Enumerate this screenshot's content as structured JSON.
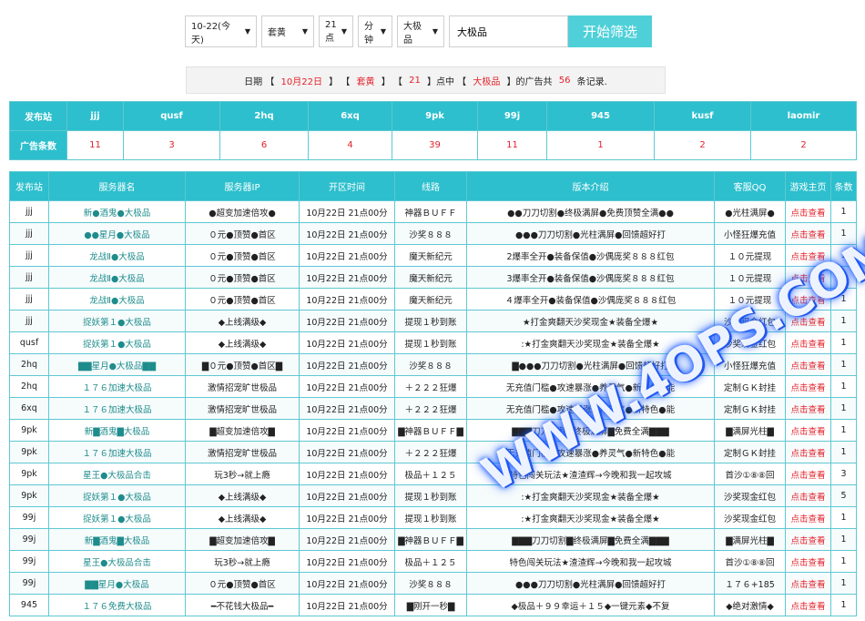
{
  "filters": {
    "date": "10-22(今天)",
    "category": "套黄",
    "hour": "21点",
    "minute": "分钟",
    "type": "大极品",
    "keyword": "大极品",
    "submit_label": "开始筛选"
  },
  "summary": {
    "prefix": "日期 【 ",
    "date": "10月22日",
    "sep1": " 】 【 ",
    "category": "套黄",
    "sep2": " 】 【 ",
    "hour": "21",
    "sep3": " 】点中 【 ",
    "type": "大极品",
    "sep4": " 】的广告共 ",
    "count": "56",
    "suffix": " 条记录."
  },
  "stats": {
    "row1_header": "发布站",
    "row2_header": "广告条数",
    "sites": [
      "jjj",
      "qusf",
      "2hq",
      "6xq",
      "9pk",
      "99j",
      "945",
      "kusf",
      "laomir"
    ],
    "counts": [
      "11",
      "3",
      "6",
      "4",
      "39",
      "11",
      "1",
      "2",
      "2"
    ]
  },
  "list": {
    "headers": [
      "发布站",
      "服务器名",
      "服务器IP",
      "开区时间",
      "线路",
      "版本介绍",
      "客服QQ",
      "游戏主页",
      "条数"
    ],
    "link_label": "点击查看",
    "rows": [
      [
        "jjj",
        "新●酒鬼●大极品",
        "●超变加速倍攻●",
        "10月22日 21点00分",
        "神器ＢＵＦＦ",
        "●●刀刀切割●终极满屏●免费顶赞全满●●",
        "●光柱满屏●",
        "1"
      ],
      [
        "jjj",
        "●●星月●大极品",
        "０元●顶赞●首区",
        "10月22日 21点00分",
        "沙奖８８８",
        "●●●刀刀切割●光柱满屏●回馈超好打",
        "小怪狂爆充值",
        "1"
      ],
      [
        "jjj",
        "龙战Ⅱ●大极品",
        "０元●顶赞●首区",
        "10月22日 21点00分",
        "魔天新纪元",
        "2爆率全开●装备保值●沙偶庞奖８８８红包",
        "１０元提现",
        "1"
      ],
      [
        "jjj",
        "龙战Ⅱ●大极品",
        "０元●顶赞●首区",
        "10月22日 21点00分",
        "魔天新纪元",
        "3爆率全开●装备保值●沙偶庞奖８８８红包",
        "１０元提现",
        "1"
      ],
      [
        "jjj",
        "龙战Ⅱ●大极品",
        "０元●顶赞●首区",
        "10月22日 21点00分",
        "魔天新纪元",
        "４爆率全开●装备保值●沙偶庞奖８８８红包",
        "１０元提现",
        "1"
      ],
      [
        "jjj",
        "捉妖第１●大极品",
        "◆上线满级◆",
        "10月22日 21点00分",
        "提现１秒到账",
        "★打金爽翻天沙奖现金★装备全爆★",
        "沙奖现金红包",
        "1"
      ],
      [
        "qusf",
        "捉妖第１●大极品",
        "◆上线满级◆",
        "10月22日 21点00分",
        "提现１秒到账",
        ":★打金爽翻天沙奖现金★装备全爆★",
        "沙奖现金红包",
        "1"
      ],
      [
        "2hq",
        "▇▇星月●大极品▇▇",
        "▇０元●顶赞●首区▇",
        "10月22日 21点00分",
        "沙奖８８８",
        "▇●●●刀刀切割●光柱满屏●回馈超好打",
        "小怪狂爆充值",
        "1"
      ],
      [
        "2hq",
        "１７６加速大极品",
        "激情招宠旷世极品",
        "10月22日 21点00分",
        "＋２２２狂爆",
        "无充值门槛●攻速暴涨●养灵气●新特色●能",
        "定制ＧＫ封挂",
        "1"
      ],
      [
        "6xq",
        "１７６加速大极品",
        "激情招宠旷世极品",
        "10月22日 21点00分",
        "＋２２２狂爆",
        "无充值门槛●攻速暴涨●养灵气●新特色●能",
        "定制ＧＫ封挂",
        "1"
      ],
      [
        "9pk",
        "新▇酒鬼▇大极品",
        "▇超变加速倍攻▇",
        "10月22日 21点00分",
        "▇神器ＢＵＦＦ▇",
        "▇▇▇刀刀切割▇终极满屏▇免费全满▇▇▇",
        "▇满屏光柱▇",
        "1"
      ],
      [
        "9pk",
        "１７６加速大极品",
        "激情招宠旷世极品",
        "10月22日 21点00分",
        "＋２２２狂爆",
        "无充值门槛●攻速暴涨●养灵气●新特色●能",
        "定制ＧＫ封挂",
        "1"
      ],
      [
        "9pk",
        "星王●大极品合击",
        "玩3秒→就上瘾",
        "10月22日 21点00分",
        "极品＋１２５",
        "特色闯关玩法★渣渣辉→今晚和我一起攻城",
        "首沙①⑧⑧回",
        "3"
      ],
      [
        "9pk",
        "捉妖第１●大极品",
        "◆上线满级◆",
        "10月22日 21点00分",
        "提现１秒到账",
        ":★打金爽翻天沙奖现金★装备全爆★",
        "沙奖现金红包",
        "5"
      ],
      [
        "99j",
        "捉妖第１●大极品",
        "◆上线满级◆",
        "10月22日 21点00分",
        "提现１秒到账",
        ":★打金爽翻天沙奖现金★装备全爆★",
        "沙奖现金红包",
        "1"
      ],
      [
        "99j",
        "新▇酒鬼▇大极品",
        "▇超变加速倍攻▇",
        "10月22日 21点00分",
        "▇神器ＢＵＦＦ▇",
        "▇▇▇刀刀切割▇终极满屏▇免费全满▇▇▇",
        "▇满屏光柱▇",
        "1"
      ],
      [
        "99j",
        "星王●大极品合击",
        "玩3秒→就上瘾",
        "10月22日 21点00分",
        "极品＋１２５",
        "特色闯关玩法★渣渣辉→今晚和我一起攻城",
        "首沙①⑧⑧回",
        "1"
      ],
      [
        "99j",
        "▇▇星月●大极品",
        "０元●顶赞●首区",
        "10月22日 21点00分",
        "沙奖８８８",
        "●●●刀刀切割●光柱满屏●回馈超好打",
        "１７６+185",
        "1"
      ],
      [
        "945",
        "１７６免费大极品",
        "━不花钱大极品━",
        "10月22日 21点00分",
        "▇刚开一秒▇",
        "◆极品＋９９幸运＋１５◆一键元素◆不复",
        "◆绝对激情◆",
        "1"
      ]
    ]
  },
  "watermark": "WWW.4OPS.COM"
}
